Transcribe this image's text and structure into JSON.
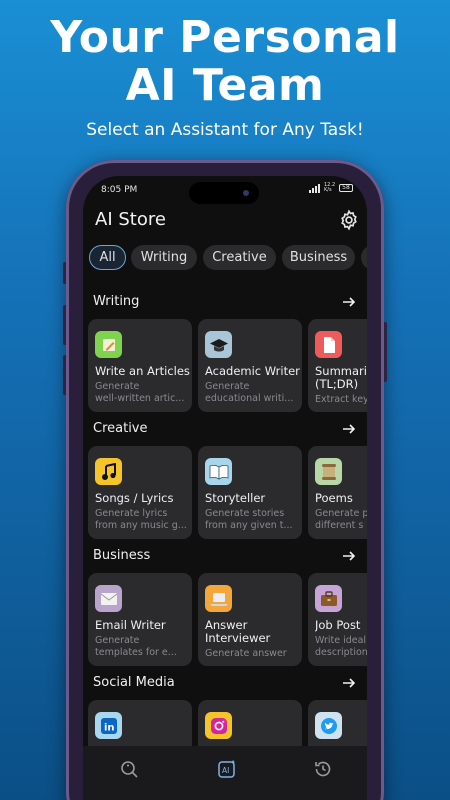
{
  "hero": {
    "title_line1": "Your Personal",
    "title_line2": "AI Team",
    "subtitle": "Select an Assistant for Any Task!"
  },
  "status": {
    "time": "8:05 PM",
    "network_top": "12.2",
    "network_bottom": "K/s",
    "battery": "58"
  },
  "app": {
    "title": "AI Store",
    "settings_icon": "gear-icon"
  },
  "tabs": [
    {
      "label": "All",
      "active": true
    },
    {
      "label": "Writing",
      "active": false
    },
    {
      "label": "Creative",
      "active": false
    },
    {
      "label": "Business",
      "active": false
    },
    {
      "label": "S",
      "active": false
    }
  ],
  "sections": [
    {
      "title": "Writing",
      "cards": [
        {
          "title": "Write an Articles",
          "desc1": "Generate",
          "desc2": "well-written artic...",
          "icon": "pencil-icon"
        },
        {
          "title": "Academic Writer",
          "desc1": "Generate",
          "desc2": "educational writi...",
          "icon": "graduation-cap-icon"
        },
        {
          "title": "Summarize",
          "title2": "(TL;DR)",
          "desc1": "Extract key",
          "desc2": "",
          "icon": "document-icon"
        }
      ]
    },
    {
      "title": "Creative",
      "cards": [
        {
          "title": "Songs / Lyrics",
          "desc1": "Generate lyrics",
          "desc2": "from any music g...",
          "icon": "music-note-icon"
        },
        {
          "title": "Storyteller",
          "desc1": "Generate stories",
          "desc2": "from any given t...",
          "icon": "open-book-icon"
        },
        {
          "title": "Poems",
          "desc1": "Generate p",
          "desc2": "different s",
          "icon": "scroll-icon"
        }
      ]
    },
    {
      "title": "Business",
      "cards": [
        {
          "title": "Email Writer",
          "desc1": "Generate",
          "desc2": "templates for e...",
          "icon": "envelope-icon"
        },
        {
          "title": "Answer",
          "title2": "Interviewer",
          "desc1": "Generate answer",
          "desc2": "",
          "icon": "laptop-icon"
        },
        {
          "title": "Job Post",
          "desc1": "Write ideal",
          "desc2": "description",
          "icon": "briefcase-icon"
        }
      ]
    },
    {
      "title": "Social Media",
      "cards": [
        {
          "title": "",
          "desc1": "",
          "desc2": "",
          "icon": "linkedin-icon"
        },
        {
          "title": "",
          "desc1": "",
          "desc2": "",
          "icon": "instagram-icon"
        },
        {
          "title": "",
          "desc1": "",
          "desc2": "",
          "icon": "twitter-icon"
        }
      ]
    }
  ],
  "bottom_nav": [
    {
      "icon": "search-sparkle-icon",
      "active": false
    },
    {
      "icon": "ai-store-icon",
      "active": true
    },
    {
      "icon": "history-icon",
      "active": false
    }
  ],
  "colors": {
    "accent_blue": "#6fa4d6",
    "card_bg": "#2b2b2e",
    "screen_bg": "#0f0f10",
    "desc_gray": "#8a8a8e"
  }
}
